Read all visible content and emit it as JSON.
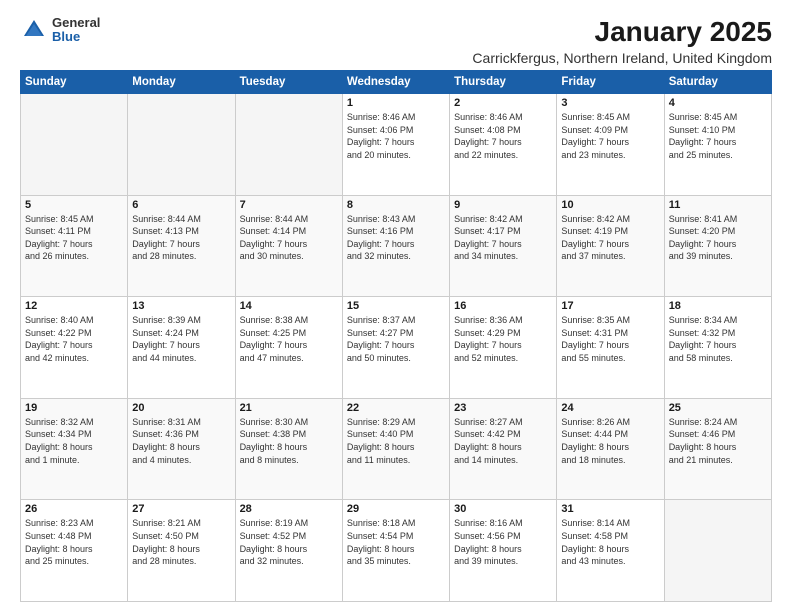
{
  "logo": {
    "general": "General",
    "blue": "Blue"
  },
  "title": "January 2025",
  "subtitle": "Carrickfergus, Northern Ireland, United Kingdom",
  "days_of_week": [
    "Sunday",
    "Monday",
    "Tuesday",
    "Wednesday",
    "Thursday",
    "Friday",
    "Saturday"
  ],
  "weeks": [
    [
      {
        "num": "",
        "info": ""
      },
      {
        "num": "",
        "info": ""
      },
      {
        "num": "",
        "info": ""
      },
      {
        "num": "1",
        "info": "Sunrise: 8:46 AM\nSunset: 4:06 PM\nDaylight: 7 hours\nand 20 minutes."
      },
      {
        "num": "2",
        "info": "Sunrise: 8:46 AM\nSunset: 4:08 PM\nDaylight: 7 hours\nand 22 minutes."
      },
      {
        "num": "3",
        "info": "Sunrise: 8:45 AM\nSunset: 4:09 PM\nDaylight: 7 hours\nand 23 minutes."
      },
      {
        "num": "4",
        "info": "Sunrise: 8:45 AM\nSunset: 4:10 PM\nDaylight: 7 hours\nand 25 minutes."
      }
    ],
    [
      {
        "num": "5",
        "info": "Sunrise: 8:45 AM\nSunset: 4:11 PM\nDaylight: 7 hours\nand 26 minutes."
      },
      {
        "num": "6",
        "info": "Sunrise: 8:44 AM\nSunset: 4:13 PM\nDaylight: 7 hours\nand 28 minutes."
      },
      {
        "num": "7",
        "info": "Sunrise: 8:44 AM\nSunset: 4:14 PM\nDaylight: 7 hours\nand 30 minutes."
      },
      {
        "num": "8",
        "info": "Sunrise: 8:43 AM\nSunset: 4:16 PM\nDaylight: 7 hours\nand 32 minutes."
      },
      {
        "num": "9",
        "info": "Sunrise: 8:42 AM\nSunset: 4:17 PM\nDaylight: 7 hours\nand 34 minutes."
      },
      {
        "num": "10",
        "info": "Sunrise: 8:42 AM\nSunset: 4:19 PM\nDaylight: 7 hours\nand 37 minutes."
      },
      {
        "num": "11",
        "info": "Sunrise: 8:41 AM\nSunset: 4:20 PM\nDaylight: 7 hours\nand 39 minutes."
      }
    ],
    [
      {
        "num": "12",
        "info": "Sunrise: 8:40 AM\nSunset: 4:22 PM\nDaylight: 7 hours\nand 42 minutes."
      },
      {
        "num": "13",
        "info": "Sunrise: 8:39 AM\nSunset: 4:24 PM\nDaylight: 7 hours\nand 44 minutes."
      },
      {
        "num": "14",
        "info": "Sunrise: 8:38 AM\nSunset: 4:25 PM\nDaylight: 7 hours\nand 47 minutes."
      },
      {
        "num": "15",
        "info": "Sunrise: 8:37 AM\nSunset: 4:27 PM\nDaylight: 7 hours\nand 50 minutes."
      },
      {
        "num": "16",
        "info": "Sunrise: 8:36 AM\nSunset: 4:29 PM\nDaylight: 7 hours\nand 52 minutes."
      },
      {
        "num": "17",
        "info": "Sunrise: 8:35 AM\nSunset: 4:31 PM\nDaylight: 7 hours\nand 55 minutes."
      },
      {
        "num": "18",
        "info": "Sunrise: 8:34 AM\nSunset: 4:32 PM\nDaylight: 7 hours\nand 58 minutes."
      }
    ],
    [
      {
        "num": "19",
        "info": "Sunrise: 8:32 AM\nSunset: 4:34 PM\nDaylight: 8 hours\nand 1 minute."
      },
      {
        "num": "20",
        "info": "Sunrise: 8:31 AM\nSunset: 4:36 PM\nDaylight: 8 hours\nand 4 minutes."
      },
      {
        "num": "21",
        "info": "Sunrise: 8:30 AM\nSunset: 4:38 PM\nDaylight: 8 hours\nand 8 minutes."
      },
      {
        "num": "22",
        "info": "Sunrise: 8:29 AM\nSunset: 4:40 PM\nDaylight: 8 hours\nand 11 minutes."
      },
      {
        "num": "23",
        "info": "Sunrise: 8:27 AM\nSunset: 4:42 PM\nDaylight: 8 hours\nand 14 minutes."
      },
      {
        "num": "24",
        "info": "Sunrise: 8:26 AM\nSunset: 4:44 PM\nDaylight: 8 hours\nand 18 minutes."
      },
      {
        "num": "25",
        "info": "Sunrise: 8:24 AM\nSunset: 4:46 PM\nDaylight: 8 hours\nand 21 minutes."
      }
    ],
    [
      {
        "num": "26",
        "info": "Sunrise: 8:23 AM\nSunset: 4:48 PM\nDaylight: 8 hours\nand 25 minutes."
      },
      {
        "num": "27",
        "info": "Sunrise: 8:21 AM\nSunset: 4:50 PM\nDaylight: 8 hours\nand 28 minutes."
      },
      {
        "num": "28",
        "info": "Sunrise: 8:19 AM\nSunset: 4:52 PM\nDaylight: 8 hours\nand 32 minutes."
      },
      {
        "num": "29",
        "info": "Sunrise: 8:18 AM\nSunset: 4:54 PM\nDaylight: 8 hours\nand 35 minutes."
      },
      {
        "num": "30",
        "info": "Sunrise: 8:16 AM\nSunset: 4:56 PM\nDaylight: 8 hours\nand 39 minutes."
      },
      {
        "num": "31",
        "info": "Sunrise: 8:14 AM\nSunset: 4:58 PM\nDaylight: 8 hours\nand 43 minutes."
      },
      {
        "num": "",
        "info": ""
      }
    ]
  ]
}
